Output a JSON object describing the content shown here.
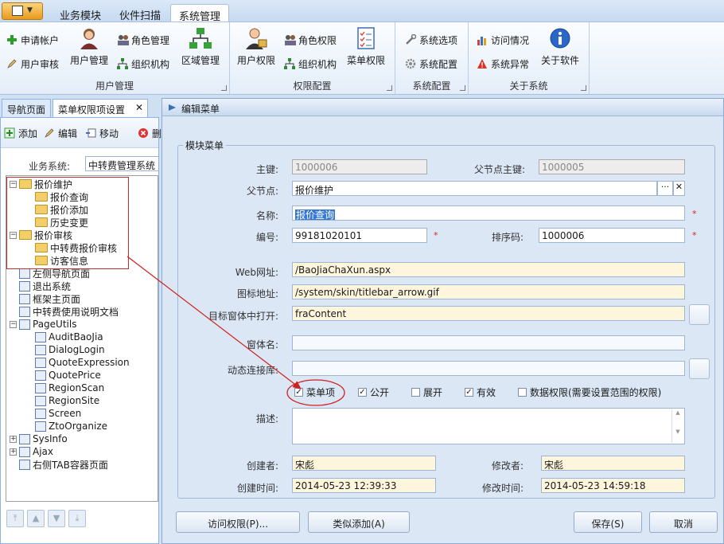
{
  "ribbon_tabs": [
    "业务模块",
    "伙件扫描",
    "系统管理"
  ],
  "groups": {
    "user_mgmt": {
      "name": "用户管理",
      "apply_account": "申请帐户",
      "user_review": "用户审核",
      "user_manage": "用户管理",
      "role_manage": "角色管理",
      "org": "组织机构",
      "region_manage": "区域管理"
    },
    "perm_config": {
      "name": "权限配置",
      "user_perm": "用户权限",
      "role_perm": "角色权限",
      "org": "组织机构",
      "menu_perm": "菜单权限"
    },
    "sys_config": {
      "name": "系统配置",
      "options": "系统选项",
      "config": "系统配置"
    },
    "about": {
      "name": "关于系统",
      "visits": "访问情况",
      "exceptions": "系统异常",
      "about_sw": "关于软件"
    }
  },
  "left": {
    "tab_nav": "导航页面",
    "tab_menu": "菜单权限项设置",
    "close_glyph": "✕",
    "tool_add": "添加",
    "tool_edit": "编辑",
    "tool_move": "移动",
    "tool_delete": "删",
    "biz_label": "业务系统:",
    "biz_value": "中转费管理系统",
    "tree": [
      {
        "label": "报价维护",
        "level": 0,
        "kind": "folder",
        "pm": "−"
      },
      {
        "label": "报价查询",
        "level": 1,
        "kind": "folder",
        "pm": ""
      },
      {
        "label": "报价添加",
        "level": 1,
        "kind": "folder",
        "pm": ""
      },
      {
        "label": "历史变更",
        "level": 1,
        "kind": "folder",
        "pm": ""
      },
      {
        "label": "报价审核",
        "level": 0,
        "kind": "folder",
        "pm": "−"
      },
      {
        "label": "中转费报价审核",
        "level": 1,
        "kind": "folder",
        "pm": ""
      },
      {
        "label": "访客信息",
        "level": 1,
        "kind": "folder",
        "pm": ""
      },
      {
        "label": "左侧导航页面",
        "level": 0,
        "kind": "page",
        "pm": ""
      },
      {
        "label": "退出系统",
        "level": 0,
        "kind": "page",
        "pm": ""
      },
      {
        "label": "框架主页面",
        "level": 0,
        "kind": "page",
        "pm": ""
      },
      {
        "label": "中转费使用说明文档",
        "level": 0,
        "kind": "page",
        "pm": ""
      },
      {
        "label": "PageUtils",
        "level": 0,
        "kind": "page",
        "pm": "−"
      },
      {
        "label": "AuditBaoJia",
        "level": 1,
        "kind": "page",
        "pm": ""
      },
      {
        "label": "DialogLogin",
        "level": 1,
        "kind": "page",
        "pm": ""
      },
      {
        "label": "QuoteExpression",
        "level": 1,
        "kind": "page",
        "pm": ""
      },
      {
        "label": "QuotePrice",
        "level": 1,
        "kind": "page",
        "pm": ""
      },
      {
        "label": "RegionScan",
        "level": 1,
        "kind": "page",
        "pm": ""
      },
      {
        "label": "RegionSite",
        "level": 1,
        "kind": "page",
        "pm": ""
      },
      {
        "label": "Screen",
        "level": 1,
        "kind": "page",
        "pm": ""
      },
      {
        "label": "ZtoOrganize",
        "level": 1,
        "kind": "page",
        "pm": ""
      },
      {
        "label": "SysInfo",
        "level": 0,
        "kind": "page",
        "pm": "+"
      },
      {
        "label": "Ajax",
        "level": 0,
        "kind": "page",
        "pm": "+"
      },
      {
        "label": "右侧TAB容器页面",
        "level": 0,
        "kind": "page",
        "pm": ""
      }
    ]
  },
  "dialog": {
    "title": "编辑菜单",
    "section": "模块菜单",
    "labels": {
      "key": "主键:",
      "parent_key": "父节点主键:",
      "parent": "父节点:",
      "name": "名称:",
      "code": "编号:",
      "sort": "排序码:",
      "web_url": "Web网址:",
      "icon_url": "图标地址:",
      "target": "目标窗体中打开:",
      "window_name": "窗体名:",
      "dynamic_lib": "动态连接库:",
      "desc": "描述:",
      "creator": "创建者:",
      "modifier": "修改者:",
      "created_at": "创建时间:",
      "modified_at": "修改时间:"
    },
    "values": {
      "key": "1000006",
      "parent_key": "1000005",
      "parent": "报价维护",
      "name": "报价查询",
      "code": "99181020101",
      "sort": "1000006",
      "web_url": "/BaoJiaChaXun.aspx",
      "icon_url": "/system/skin/titlebar_arrow.gif",
      "target": "fraContent",
      "window_name": "",
      "dynamic_lib": "",
      "desc": "",
      "creator": "宋彪",
      "modifier": "宋彪",
      "created_at": "2014-05-23 12:39:33",
      "modified_at": "2014-05-23 14:59:18"
    },
    "parent_browse": "···",
    "parent_clear": "✕",
    "required_mark": "*",
    "checkboxes": [
      {
        "label": "菜单项",
        "checked": true
      },
      {
        "label": "公开",
        "checked": true
      },
      {
        "label": "展开",
        "checked": false
      },
      {
        "label": "有效",
        "checked": true
      },
      {
        "label": "数据权限(需要设置范围的权限)",
        "checked": false
      }
    ],
    "buttons": {
      "access": "访问权限(P)...",
      "similar_add": "类似添加(A)",
      "save": "保存(S)",
      "cancel": "取消"
    }
  },
  "nav_arrows": [
    "⤒",
    "▲",
    "▼",
    "⤓"
  ]
}
